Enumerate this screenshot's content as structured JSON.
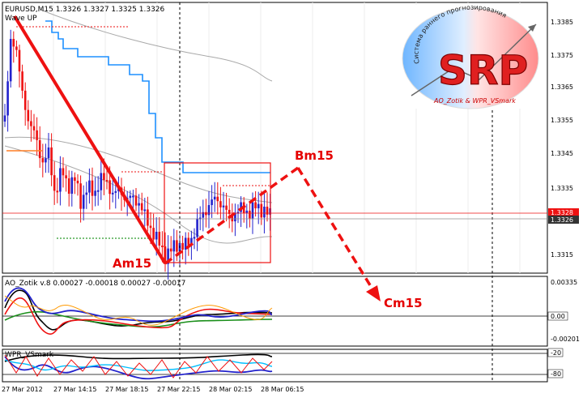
{
  "header": {
    "symbol_line": "EURUSD,M15  1.3326 1.3327 1.3325 1.3326",
    "indicator_name": "Wave UP"
  },
  "logo": {
    "letters": "SRP",
    "arc_text": "Система раннего прогнозирования",
    "footer_text": "AO_Zotik & WPR_VSmark"
  },
  "price_axis": {
    "ticks": [
      "1.3385",
      "1.3375",
      "1.3365",
      "1.3355",
      "1.3345",
      "1.3335",
      "1.3315"
    ],
    "bid_label": "1.3328",
    "ask_label": "1.3326"
  },
  "wave_labels": {
    "a": "Am15",
    "b": "Bm15",
    "c": "Cm15"
  },
  "ao_panel": {
    "title": "AO_Zotik  v.8  0.00027 -0.00018 0.00027 -0.00017",
    "ticks": [
      "0.00335",
      "0.00",
      "-0.00201"
    ]
  },
  "wpr_panel": {
    "title": "WPR_VSmark",
    "ticks": [
      "-20",
      "-80"
    ]
  },
  "time_axis": {
    "labels": [
      "27 Mar 2012",
      "27 Mar 14:15",
      "27 Mar 18:15",
      "27 Mar 22:15",
      "28 Mar 02:15",
      "28 Mar 06:15"
    ]
  },
  "colors": {
    "bull": "#2222cc",
    "bear": "#ee1111",
    "wave": "#ee1111",
    "band": "#1e90ff",
    "ma": "#a9a9a9"
  }
}
